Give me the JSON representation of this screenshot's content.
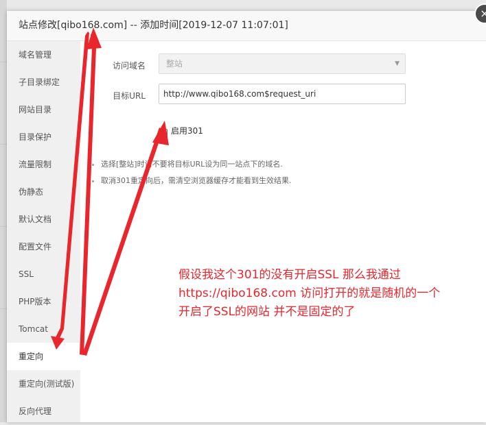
{
  "dialog": {
    "title": "站点修改[qibo168.com] -- 添加时间[2019-12-07 11:07:01]",
    "close_icon": "×"
  },
  "sidebar": {
    "active_index": 12,
    "items": [
      {
        "label": "域名管理"
      },
      {
        "label": "子目录绑定"
      },
      {
        "label": "网站目录"
      },
      {
        "label": "目录保护"
      },
      {
        "label": "流量限制"
      },
      {
        "label": "伪静态"
      },
      {
        "label": "默认文档"
      },
      {
        "label": "配置文件"
      },
      {
        "label": "SSL"
      },
      {
        "label": "PHP版本"
      },
      {
        "label": "Tomcat"
      },
      {
        "label": "重定向"
      },
      {
        "label": "重定向(测试版)"
      },
      {
        "label": "反向代理"
      }
    ]
  },
  "form": {
    "domain_label": "访问域名",
    "domain_value": "整站",
    "target_label": "目标URL",
    "target_value": "http://www.qibo168.com$request_uri",
    "enable_301_label": "启用301",
    "enable_301_checked": true,
    "check_glyph": "✔"
  },
  "tips": [
    "选择[整站]时请不要将目标URL设为同一站点下的域名.",
    "取消301重定向后，需清空浏览器缓存才能看到生效结果."
  ],
  "annotation": {
    "lines": [
      "假设我这个301的没有开启SSL 那么我通过",
      "https://qibo168.com 访问打开的就是随机的一个",
      "开启了SSL的网站 并不是固定的了"
    ],
    "color": "#e8262c"
  }
}
